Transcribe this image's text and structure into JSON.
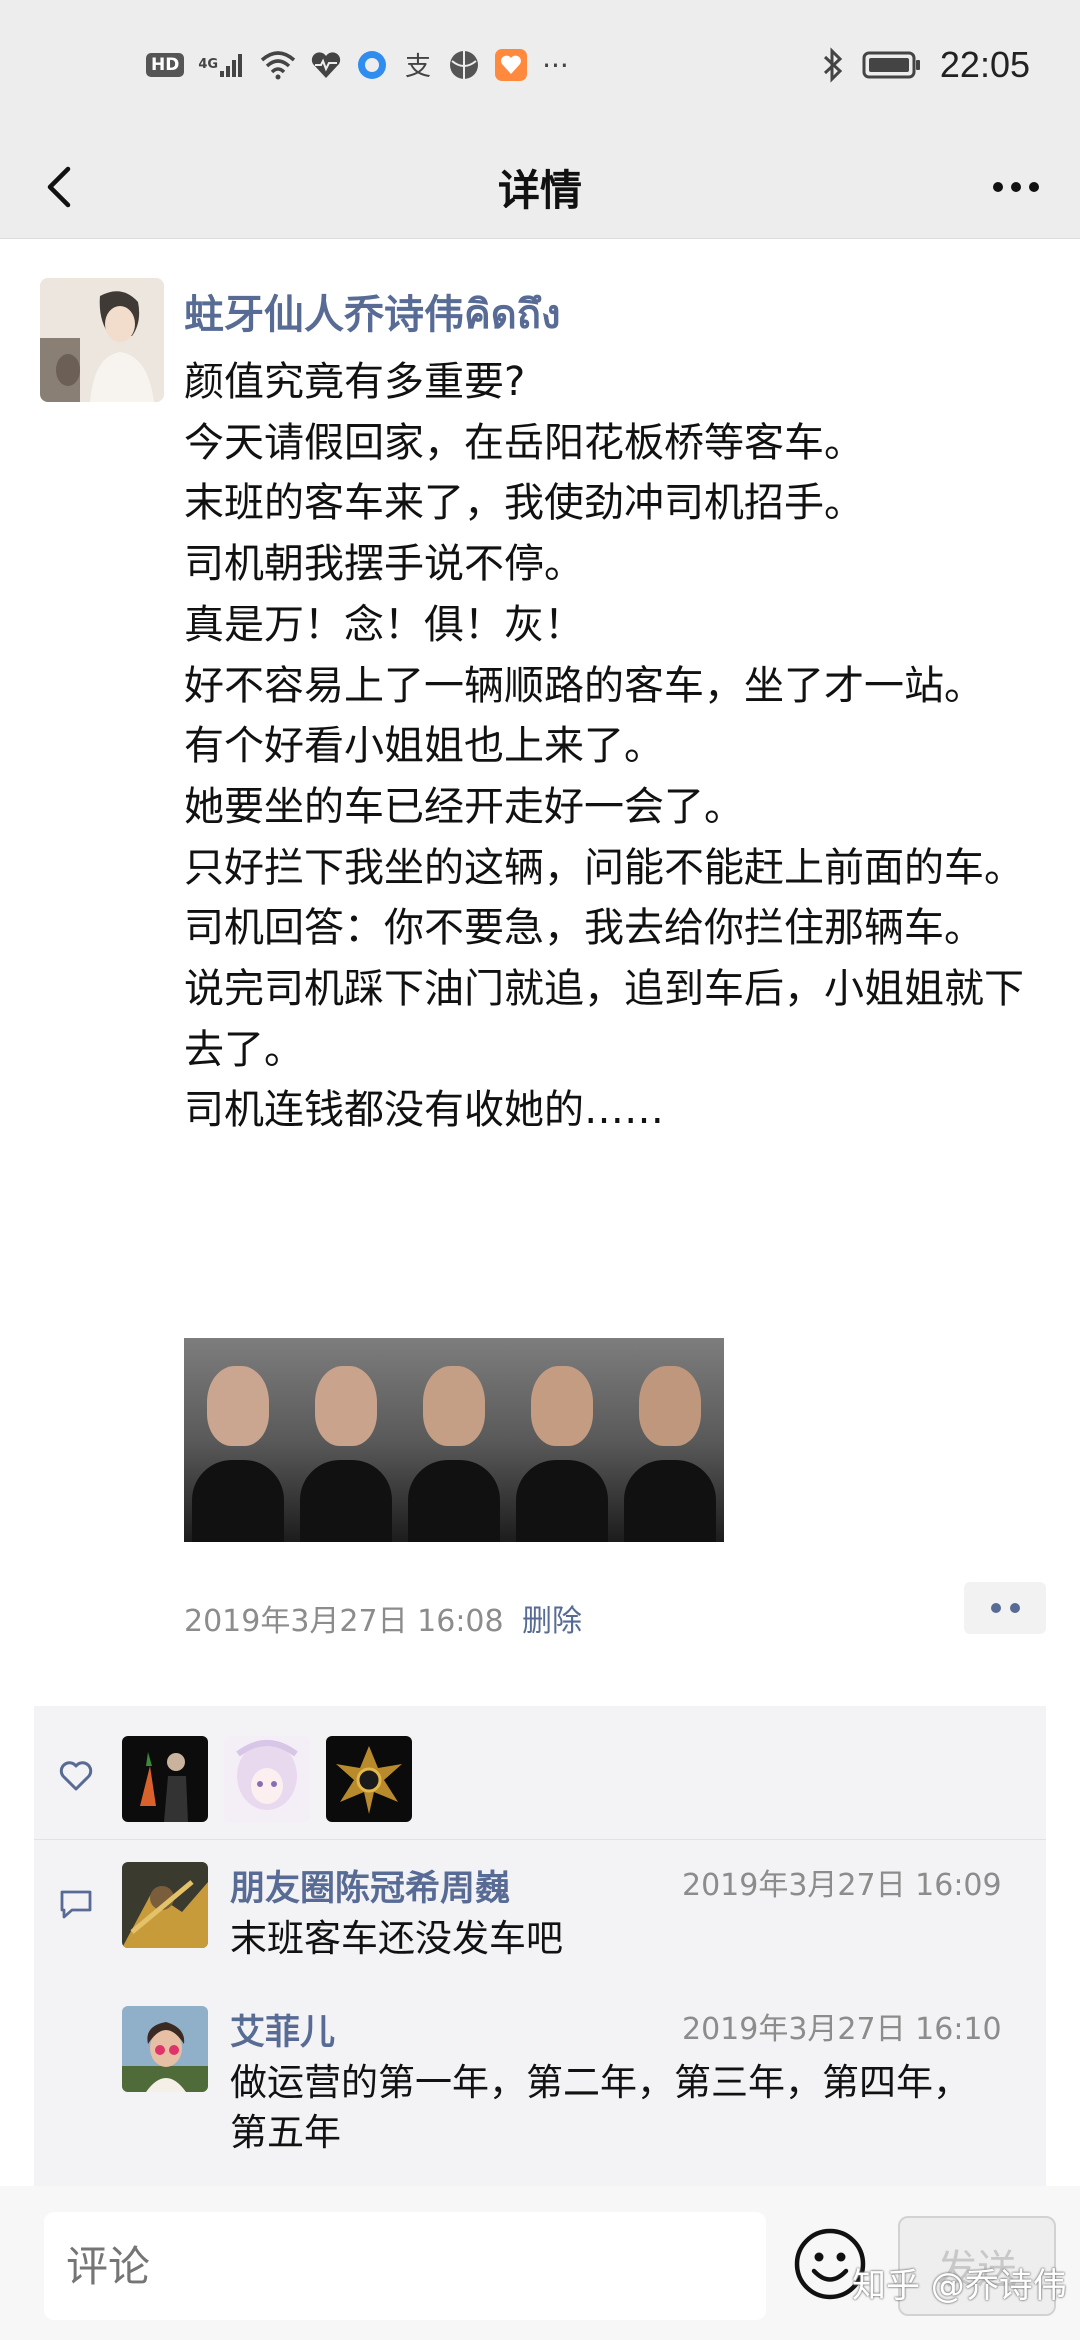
{
  "status_bar": {
    "network_badge": "HD",
    "signal_label": "4G",
    "time": "22:05",
    "more": "···"
  },
  "nav": {
    "title": "详情"
  },
  "post": {
    "author": "蛀牙仙人乔诗伟คิดถึง",
    "lines": [
      "颜值究竟有多重要?",
      "今天请假回家，在岳阳花板桥等客车。",
      "末班的客车来了，我使劲冲司机招手。",
      "司机朝我摆手说不停。",
      "真是万！念！俱！灰！",
      "好不容易上了一辆顺路的客车，坐了才一站。",
      "有个好看小姐姐也上来了。",
      "她要坐的车已经开走好一会了。",
      "只好拦下我坐的这辆，问能不能赶上前面的车。",
      "司机回答：你不要急，我去给你拦住那辆车。",
      "说完司机踩下油门就追，追到车后，小姐姐就下去了。",
      "司机连钱都没有收她的……"
    ],
    "time": "2019年3月27日 16:08",
    "delete_label": "删除"
  },
  "comments": [
    {
      "name": "朋友圈陈冠希周巍",
      "time": "2019年3月27日 16:09",
      "text": "末班客车还没发车吧"
    },
    {
      "name": "艾菲儿",
      "time": "2019年3月27日 16:10",
      "text": "做运营的第一年，第二年，第三年，第四年，第五年"
    }
  ],
  "input": {
    "placeholder": "评论",
    "send_label": "发送"
  },
  "watermark": "知乎 @乔诗伟",
  "colors": {
    "link": "#576b95",
    "background": "#ededed",
    "meta": "#8c8c8c"
  }
}
